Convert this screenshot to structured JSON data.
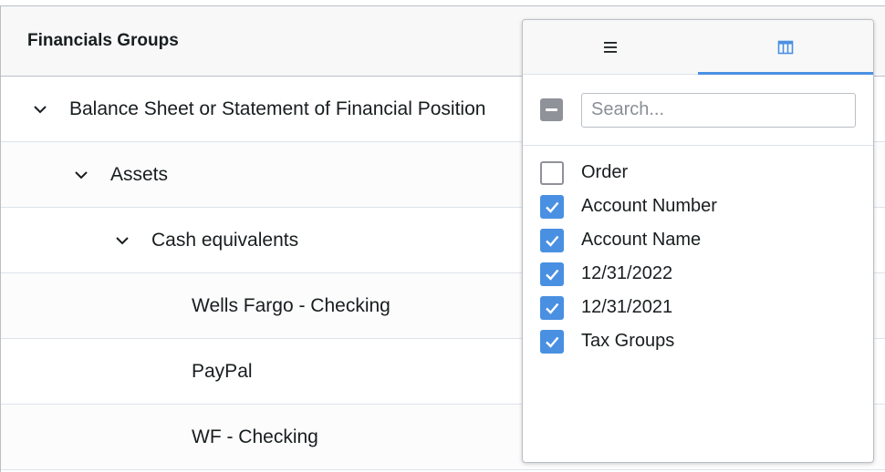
{
  "grid": {
    "header": "Financials Groups",
    "rows": [
      {
        "label": "Balance Sheet or Statement of Financial Position",
        "level": 0,
        "expanded": true
      },
      {
        "label": "Assets",
        "level": 1,
        "expanded": true
      },
      {
        "label": "Cash equivalents",
        "level": 2,
        "expanded": true
      },
      {
        "label": "Wells Fargo - Checking",
        "level": 3
      },
      {
        "label": "PayPal",
        "level": 3
      },
      {
        "label": "WF - Checking",
        "level": 3
      }
    ]
  },
  "panel": {
    "tabs": [
      {
        "icon": "menu-icon",
        "active": false
      },
      {
        "icon": "columns-icon",
        "active": true
      }
    ],
    "search": {
      "placeholder": "Search...",
      "value": ""
    },
    "columns": [
      {
        "label": "Order",
        "checked": false
      },
      {
        "label": "Account Number",
        "checked": true
      },
      {
        "label": "Account Name",
        "checked": true
      },
      {
        "label": "12/31/2022",
        "checked": true
      },
      {
        "label": "12/31/2021",
        "checked": true
      },
      {
        "label": "Tax Groups",
        "checked": true
      }
    ]
  },
  "colors": {
    "accent": "#4a90e2",
    "border": "#babfc7",
    "indeterminate": "#8f9299"
  }
}
